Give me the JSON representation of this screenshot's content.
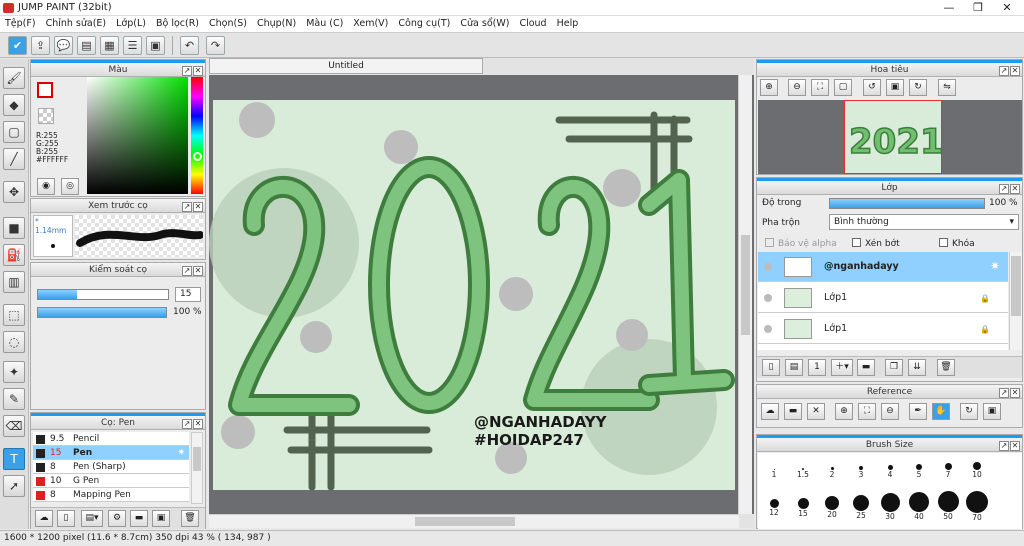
{
  "window": {
    "title": "JUMP PAINT (32bit)",
    "minimize": "—",
    "maximize": "❐",
    "close": "✕"
  },
  "menu": [
    "Tệp(F)",
    "Chỉnh sửa(E)",
    "Lớp(L)",
    "Bộ lọc(R)",
    "Chọn(S)",
    "Chụp(N)",
    "Màu (C)",
    "Xem(V)",
    "Công cụ(T)",
    "Cửa sổ(W)",
    "Cloud",
    "Help"
  ],
  "color_panel": {
    "title": "Màu",
    "r": "R:255",
    "g": "G:255",
    "b": "B:255",
    "hex": "#FFFFFF"
  },
  "brush_preview": {
    "title": "Xem trước cọ",
    "size": "* 1.14mm"
  },
  "brush_control": {
    "title": "Kiểm soát cọ",
    "size_value": "15",
    "opacity_value": "100 %",
    "size_fraction": 0.3,
    "opacity_fraction": 1.0
  },
  "brush_list": {
    "title": "Cọ: Pen",
    "items": [
      {
        "size": "9.5",
        "name": "Pencil",
        "color": "#222222"
      },
      {
        "size": "15",
        "name": "Pen",
        "color": "#222222"
      },
      {
        "size": "8",
        "name": "Pen (Sharp)",
        "color": "#222222"
      },
      {
        "size": "10",
        "name": "G Pen",
        "color": "#e02020"
      },
      {
        "size": "8",
        "name": "Mapping Pen",
        "color": "#e02020"
      }
    ]
  },
  "canvas": {
    "tab_label": "Untitled",
    "watermark_line1": "@NGANHADAYY",
    "watermark_line2": "#HOIDAP247",
    "numbers": [
      "2",
      "0",
      "2",
      "1"
    ]
  },
  "navigator": {
    "title": "Hoa tiêu"
  },
  "layer_panel": {
    "title": "Lớp",
    "opacity_label": "Độ trong",
    "opacity_value": "100 %",
    "opacity_fraction": 1.0,
    "blend_label": "Pha trộn",
    "blend_value": "Bình thường",
    "protect_alpha": "Bảo vệ alpha",
    "clipping": "Xén bớt",
    "lock": "Khóa",
    "layers": [
      {
        "name": "@nganhadayy"
      },
      {
        "name": "Lớp1"
      },
      {
        "name": "Lớp1"
      }
    ]
  },
  "reference": {
    "title": "Reference"
  },
  "brush_size": {
    "title": "Brush Size",
    "row1": [
      "1",
      "1.5",
      "2",
      "3",
      "4",
      "5",
      "7",
      "10"
    ],
    "row2": [
      "12",
      "15",
      "20",
      "25",
      "30",
      "40",
      "50",
      "70"
    ]
  },
  "status": {
    "text": "1600 * 1200 pixel   (11.6 * 8.7cm)   350 dpi   43 %   ( 134, 987 )"
  },
  "colors": {
    "accent": "#1d9bf0",
    "selected": "#8fd0ff",
    "canvas_bg": "#d9ecd9",
    "digit_fill": "#6fbf6f",
    "digit_dark": "#3e7d3e"
  }
}
